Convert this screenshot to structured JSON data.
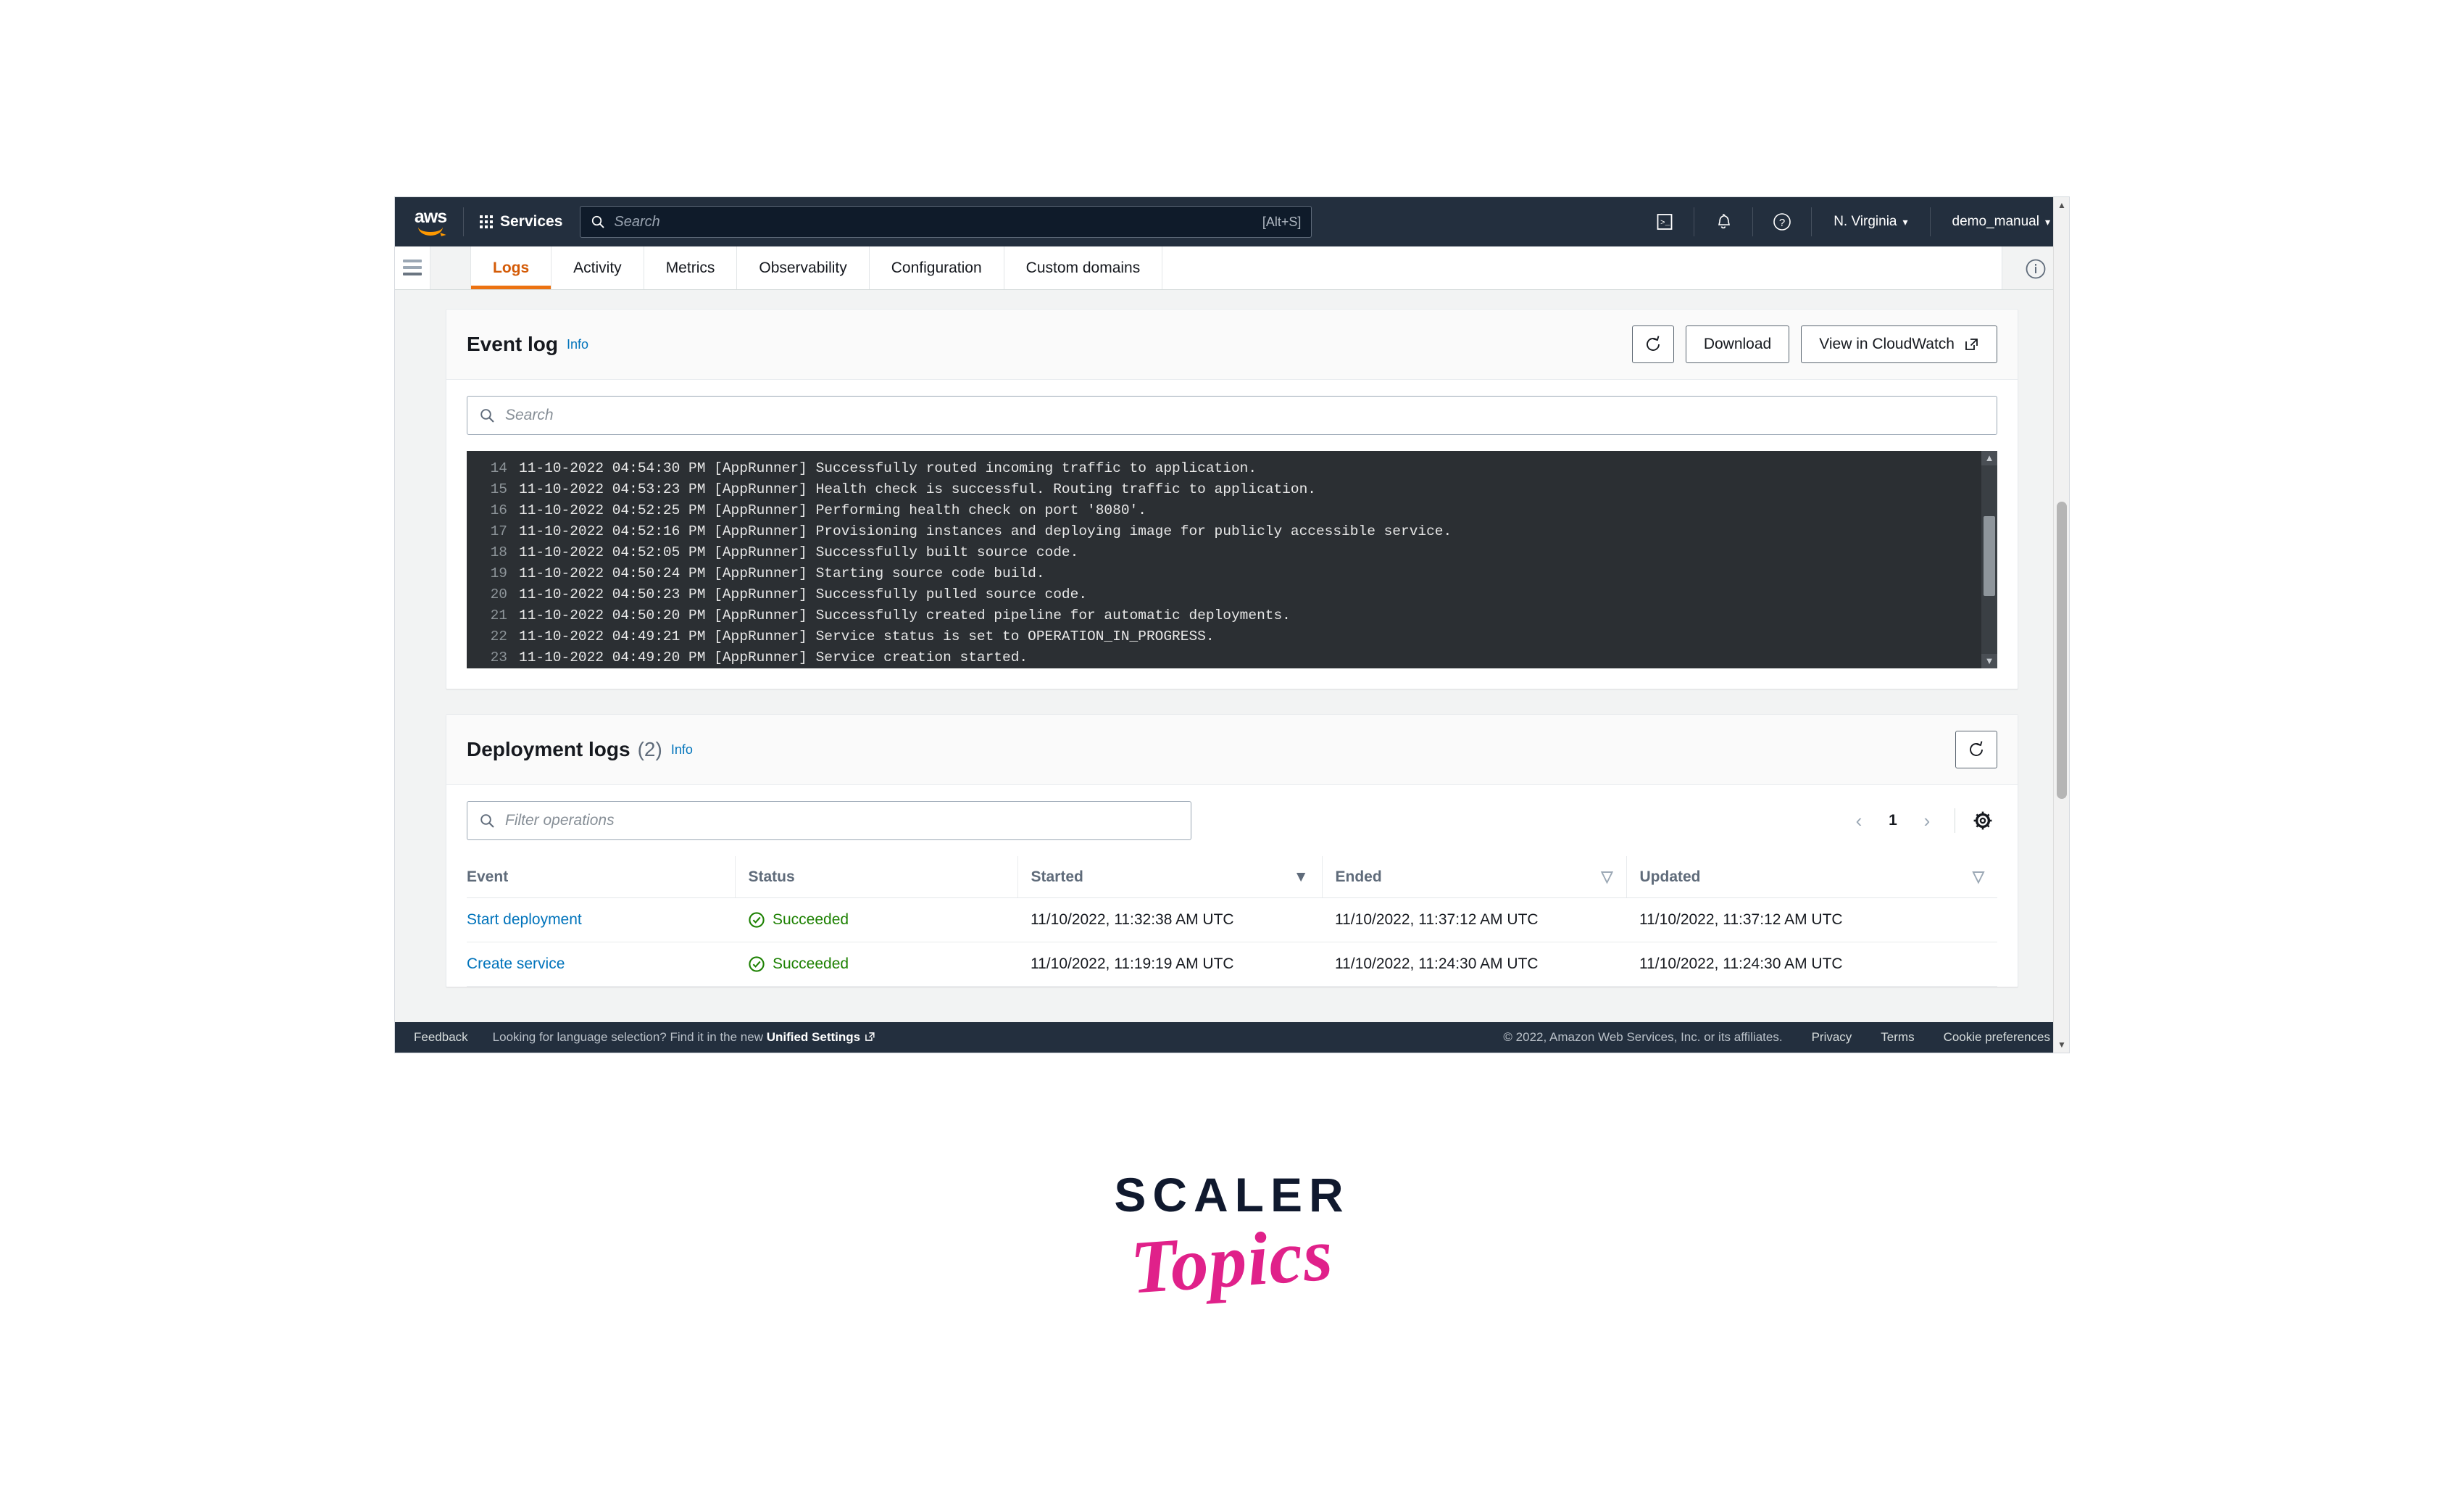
{
  "topnav": {
    "logo_text": "aws",
    "logo_icon": "aws-logo-icon",
    "services_label": "Services",
    "services_icon": "grid-apps-icon",
    "search": {
      "value": "",
      "placeholder": "Search",
      "shortcut": "[Alt+S]",
      "icon": "search-icon"
    },
    "cloudshell_icon": "cloudshell-icon",
    "notifications_icon": "bell-icon",
    "help_icon": "question-circle-icon",
    "region_label": "N. Virginia",
    "account_label": "demo_manual",
    "caret_icon": "caret-down-icon"
  },
  "subnav": {
    "menu_icon": "hamburger-menu-icon",
    "info_icon": "info-circle-icon",
    "tabs": [
      {
        "label": "Logs",
        "active": true
      },
      {
        "label": "Activity",
        "active": false
      },
      {
        "label": "Metrics",
        "active": false
      },
      {
        "label": "Observability",
        "active": false
      },
      {
        "label": "Configuration",
        "active": false
      },
      {
        "label": "Custom domains",
        "active": false
      }
    ]
  },
  "event_log": {
    "title": "Event log",
    "info_label": "Info",
    "refresh_icon": "refresh-icon",
    "download_label": "Download",
    "cloudwatch_label": "View in CloudWatch",
    "external_icon": "external-link-icon",
    "search": {
      "value": "",
      "placeholder": "Search",
      "icon": "search-icon"
    },
    "lines": [
      {
        "n": "14",
        "text": "11-10-2022 04:54:30 PM [AppRunner] Successfully routed incoming traffic to application."
      },
      {
        "n": "15",
        "text": "11-10-2022 04:53:23 PM [AppRunner] Health check is successful. Routing traffic to application."
      },
      {
        "n": "16",
        "text": "11-10-2022 04:52:25 PM [AppRunner] Performing health check on port '8080'."
      },
      {
        "n": "17",
        "text": "11-10-2022 04:52:16 PM [AppRunner] Provisioning instances and deploying image for publicly accessible service."
      },
      {
        "n": "18",
        "text": "11-10-2022 04:52:05 PM [AppRunner] Successfully built source code."
      },
      {
        "n": "19",
        "text": "11-10-2022 04:50:24 PM [AppRunner] Starting source code build."
      },
      {
        "n": "20",
        "text": "11-10-2022 04:50:23 PM [AppRunner] Successfully pulled source code."
      },
      {
        "n": "21",
        "text": "11-10-2022 04:50:20 PM [AppRunner] Successfully created pipeline for automatic deployments."
      },
      {
        "n": "22",
        "text": "11-10-2022 04:49:21 PM [AppRunner] Service status is set to OPERATION_IN_PROGRESS."
      },
      {
        "n": "23",
        "text": "11-10-2022 04:49:20 PM [AppRunner] Service creation started."
      }
    ]
  },
  "deployment_logs": {
    "title": "Deployment logs",
    "count": "(2)",
    "info_label": "Info",
    "refresh_icon": "refresh-icon",
    "filter": {
      "value": "",
      "placeholder": "Filter operations",
      "icon": "search-icon"
    },
    "pager": {
      "prev_icon": "chevron-left-icon",
      "page": "1",
      "next_icon": "chevron-right-icon",
      "settings_icon": "gear-icon"
    },
    "columns": [
      {
        "label": "Event",
        "sort": ""
      },
      {
        "label": "Status",
        "sort": ""
      },
      {
        "label": "Started",
        "sort": "sort-desc-filled-icon"
      },
      {
        "label": "Ended",
        "sort": "sort-outline-icon"
      },
      {
        "label": "Updated",
        "sort": "sort-outline-icon"
      }
    ],
    "rows": [
      {
        "event": "Start deployment",
        "status": "Succeeded",
        "status_icon": "check-circle-icon",
        "started": "11/10/2022, 11:32:38 AM UTC",
        "ended": "11/10/2022, 11:37:12 AM UTC",
        "updated": "11/10/2022, 11:37:12 AM UTC"
      },
      {
        "event": "Create service",
        "status": "Succeeded",
        "status_icon": "check-circle-icon",
        "started": "11/10/2022, 11:19:19 AM UTC",
        "ended": "11/10/2022, 11:24:30 AM UTC",
        "updated": "11/10/2022, 11:24:30 AM UTC"
      }
    ]
  },
  "footer": {
    "feedback_label": "Feedback",
    "language_prefix": "Looking for language selection? Find it in the new ",
    "language_link": "Unified Settings",
    "external_icon": "external-link-icon",
    "copyright": "© 2022, Amazon Web Services, Inc. or its affiliates.",
    "privacy_label": "Privacy",
    "terms_label": "Terms",
    "cookie_label": "Cookie preferences"
  },
  "brand": {
    "line1": "SCALER",
    "line2": "Topics"
  },
  "colors": {
    "nav_bg": "#232f3e",
    "accent_orange": "#ec7211",
    "link_blue": "#0073bb",
    "success_green": "#1d8102",
    "brand_pink": "#e0218a",
    "console_bg": "#2b2f33"
  }
}
